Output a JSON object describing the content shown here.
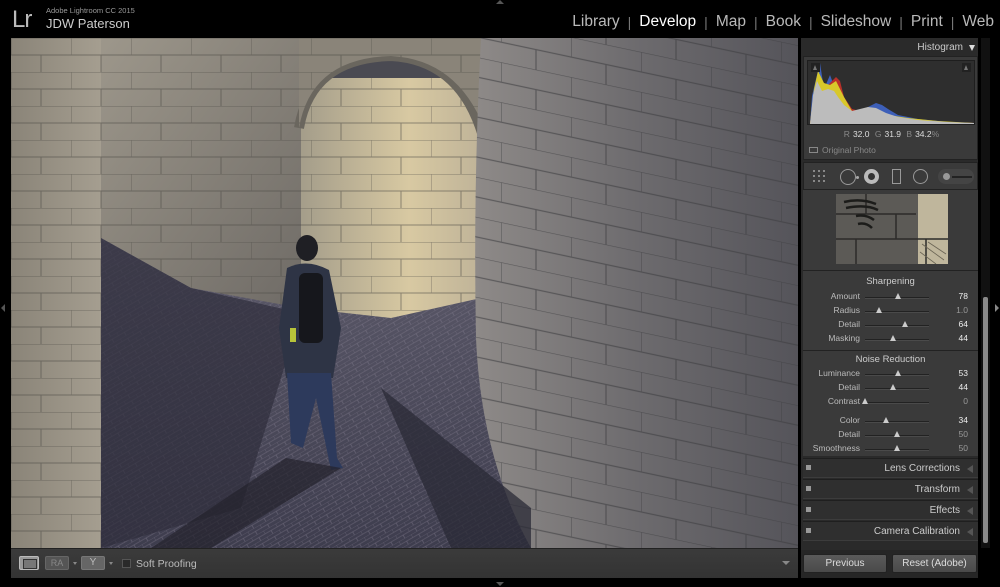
{
  "app": {
    "product": "Adobe Lightroom CC 2015",
    "logo": "Lr",
    "user": "JDW Paterson"
  },
  "modules": [
    {
      "label": "Library",
      "active": false
    },
    {
      "label": "Develop",
      "active": true
    },
    {
      "label": "Map",
      "active": false
    },
    {
      "label": "Book",
      "active": false
    },
    {
      "label": "Slideshow",
      "active": false
    },
    {
      "label": "Print",
      "active": false
    },
    {
      "label": "Web",
      "active": false
    }
  ],
  "module_separator": "|",
  "histogram": {
    "title": "Histogram",
    "readout": {
      "r_label": "R",
      "r": "32.0",
      "g_label": "G",
      "g": "31.9",
      "b_label": "B",
      "b": "34.2",
      "unit": "%"
    },
    "original_photo_label": "Original Photo"
  },
  "tools": [
    "crop-overlay",
    "spot-removal",
    "red-eye-correction",
    "graduated-filter",
    "radial-filter",
    "adjustment-brush"
  ],
  "sharpening": {
    "title": "Sharpening",
    "sliders": [
      {
        "label": "Amount",
        "value": "78",
        "position": 0.52,
        "dim": false
      },
      {
        "label": "Radius",
        "value": "1.0",
        "position": 0.22,
        "dim": true
      },
      {
        "label": "Detail",
        "value": "64",
        "position": 0.64,
        "dim": false
      },
      {
        "label": "Masking",
        "value": "44",
        "position": 0.44,
        "dim": false
      }
    ]
  },
  "noise_reduction": {
    "title": "Noise Reduction",
    "sliders": [
      {
        "label": "Luminance",
        "value": "53",
        "position": 0.53,
        "dim": false
      },
      {
        "label": "Detail",
        "value": "44",
        "position": 0.44,
        "dim": false
      },
      {
        "label": "Contrast",
        "value": "0",
        "position": 0.0,
        "dim": true
      }
    ],
    "color_sliders": [
      {
        "label": "Color",
        "value": "34",
        "position": 0.34,
        "dim": false
      },
      {
        "label": "Detail",
        "value": "50",
        "position": 0.5,
        "dim": true
      },
      {
        "label": "Smoothness",
        "value": "50",
        "position": 0.5,
        "dim": true
      }
    ]
  },
  "collapsed_panels": [
    "Lens Corrections",
    "Transform",
    "Effects",
    "Camera Calibration"
  ],
  "buttons": {
    "previous": "Previous",
    "reset": "Reset (Adobe)"
  },
  "toolbar": {
    "compare_label": "RA",
    "survey_label": "Y",
    "soft_proofing": "Soft Proofing",
    "soft_proofing_checked": false
  }
}
